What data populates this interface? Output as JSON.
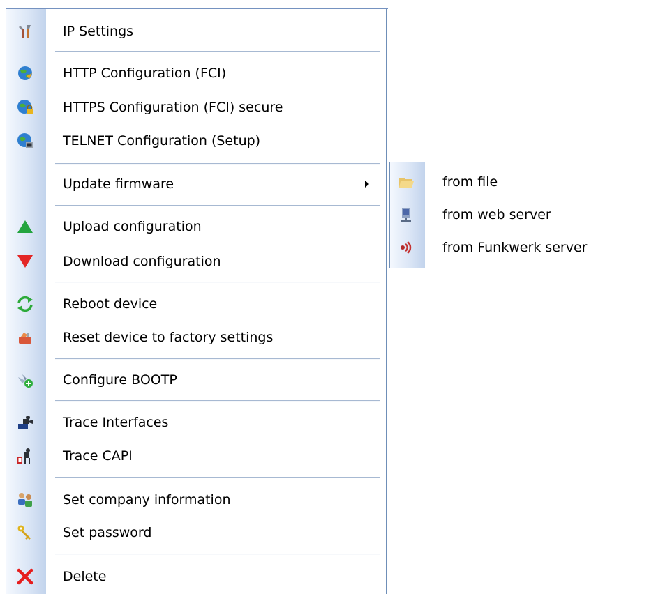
{
  "context_menu": {
    "items": [
      {
        "label": "IP Settings",
        "icon": "tools-icon"
      },
      {
        "label": "HTTP Configuration (FCI)",
        "icon": "globe-icon"
      },
      {
        "label": "HTTPS Configuration (FCI) secure",
        "icon": "globe-lock-icon"
      },
      {
        "label": "TELNET Configuration (Setup)",
        "icon": "globe-terminal-icon"
      },
      {
        "label": "Update firmware",
        "icon": "none",
        "has_submenu": true
      },
      {
        "label": "Upload configuration",
        "icon": "triangle-up-icon"
      },
      {
        "label": "Download configuration",
        "icon": "triangle-down-icon"
      },
      {
        "label": "Reboot device",
        "icon": "refresh-icon"
      },
      {
        "label": "Reset device to factory settings",
        "icon": "factory-reset-icon"
      },
      {
        "label": "Configure BOOTP",
        "icon": "network-add-icon"
      },
      {
        "label": "Trace Interfaces",
        "icon": "trace-interfaces-icon"
      },
      {
        "label": "Trace CAPI",
        "icon": "trace-capi-icon"
      },
      {
        "label": "Set company information",
        "icon": "users-icon"
      },
      {
        "label": "Set password",
        "icon": "key-icon"
      },
      {
        "label": "Delete",
        "icon": "delete-icon"
      }
    ]
  },
  "submenu": {
    "items": [
      {
        "label": "from file",
        "icon": "folder-icon"
      },
      {
        "label": "from web server",
        "icon": "server-icon"
      },
      {
        "label": "from Funkwerk server",
        "icon": "speaker-icon"
      }
    ]
  },
  "colors": {
    "menu_border": "#6f8fb8",
    "gutter_start": "#f4f8fe",
    "gutter_end": "#c2d3ec",
    "separator": "#a7b9d2",
    "upload_green": "#23a43f",
    "download_red": "#e32626",
    "delete_red": "#e61e1e"
  }
}
